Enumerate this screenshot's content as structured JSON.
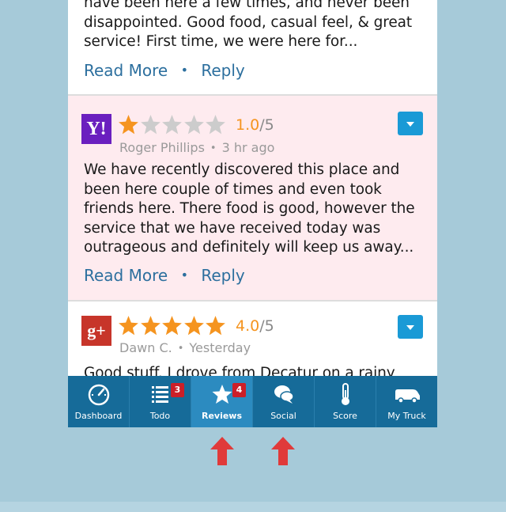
{
  "reviews": [
    {
      "text": "have been here a few times, and never been disappointed.  Good food, casual feel, & great service!  First time, we were here for...",
      "read_more": "Read More",
      "reply": "Reply"
    },
    {
      "source": "Yelp",
      "logo_text": "Y!",
      "rating_value": "1.0",
      "rating_max": "/5",
      "stars_filled": 1,
      "author": "Roger Phillips",
      "time": "3 hr ago",
      "text": "We have recently discovered this place and been here couple of times and even took friends here. There food is good, however the service that we have received today was outrageous and definitely will keep us away...",
      "read_more": "Read More",
      "reply": "Reply"
    },
    {
      "source": "Google+",
      "logo_text": "g+",
      "rating_value": "4.0",
      "rating_max": "/5",
      "stars_filled": 5,
      "author": "Dawn C.",
      "time": "Yesterday",
      "text": "Good stuff.  I drove from Decatur on a rainy"
    }
  ],
  "separator": "•",
  "tabs": [
    {
      "label": "Dashboard",
      "icon": "gauge-icon"
    },
    {
      "label": "Todo",
      "icon": "list-icon",
      "badge": "3"
    },
    {
      "label": "Reviews",
      "icon": "star-icon",
      "badge": "4",
      "active": true
    },
    {
      "label": "Social",
      "icon": "chat-bubbles-icon"
    },
    {
      "label": "Score",
      "icon": "thermometer-icon"
    },
    {
      "label": "My Truck",
      "icon": "truck-icon"
    }
  ],
  "colors": {
    "tab_bar": "#166b99",
    "tab_active": "#2c8bc0",
    "accent_link": "#2c6f9e",
    "rating_orange": "#f5941f",
    "badge_red": "#cc1f28",
    "arrow_red": "#e03a3a",
    "highlight_card": "#feebef"
  }
}
